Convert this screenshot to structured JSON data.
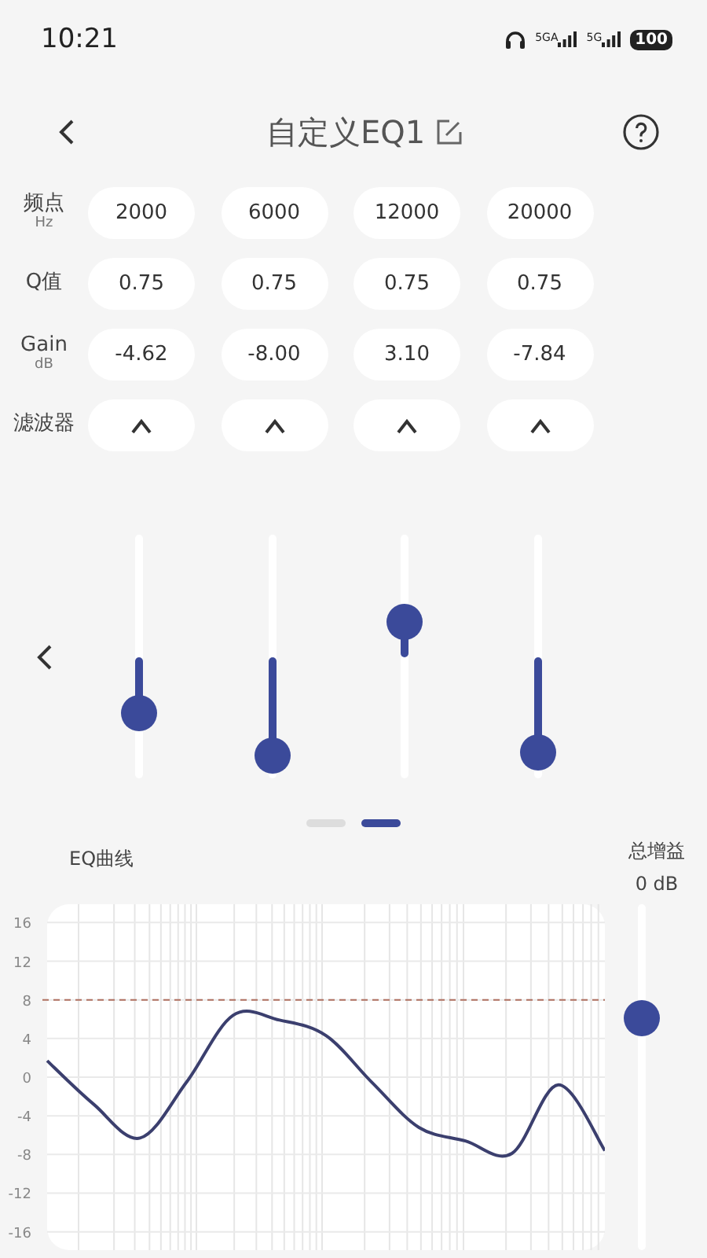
{
  "status_bar": {
    "time": "10:21",
    "network_1": "5GA",
    "network_2": "5G",
    "battery": "100"
  },
  "header": {
    "title": "自定义EQ1"
  },
  "params": {
    "rows": [
      {
        "label": "频点",
        "unit": "Hz",
        "values": [
          "2000",
          "6000",
          "12000",
          "20000"
        ],
        "kind": "text"
      },
      {
        "label": "Q值",
        "values": [
          "0.75",
          "0.75",
          "0.75",
          "0.75"
        ],
        "kind": "text"
      },
      {
        "label": "Gain",
        "unit": "dB",
        "values": [
          "-4.62",
          "-8.00",
          "3.10",
          "-7.84"
        ],
        "kind": "text"
      },
      {
        "label": "滤波器",
        "cells": [
          {
            "kind": "peak"
          },
          {
            "kind": "peak"
          },
          {
            "kind": "peak"
          },
          {
            "kind": "peak"
          }
        ],
        "kind": "filter"
      }
    ]
  },
  "bands": [
    {
      "level": 0.27
    },
    {
      "level": 0.1
    },
    {
      "level": 0.645
    },
    {
      "level": 0.11
    }
  ],
  "pager": [
    {
      "selected": false
    },
    {
      "selected": true
    }
  ],
  "eq_curve": {
    "title": "EQ曲线",
    "chart_data": {
      "type": "line",
      "series": [
        {
          "color": "#3b3f6e",
          "values": [
            1.7,
            -2.8,
            -6.3,
            -0.5,
            6.4,
            5.9,
            4.3,
            -0.6,
            -5.2,
            -6.6,
            -7.9,
            -0.8,
            -7.6
          ]
        }
      ],
      "ylim": [
        -17.9,
        17.9
      ],
      "yticks": [
        16,
        12,
        8,
        4,
        0,
        -4,
        -8,
        -12,
        -16
      ],
      "grid": true,
      "ref_lines": [
        {
          "axis": "y",
          "value": 8
        }
      ]
    }
  },
  "total_gain": {
    "label": "总增益",
    "reading": "0 dB",
    "level": 0.67
  }
}
